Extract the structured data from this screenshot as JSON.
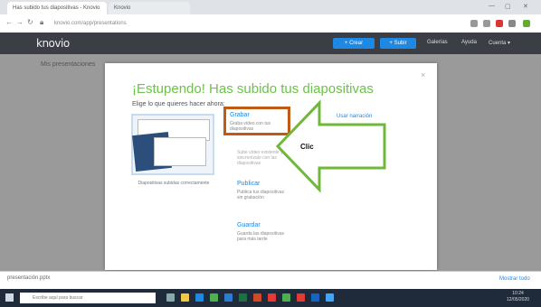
{
  "browser": {
    "tabs": [
      {
        "label": "Has subido tus diapositivas - Knovio"
      },
      {
        "label": "Knovio"
      }
    ],
    "url": "knovio.com/app/presentations",
    "controls": [
      "—",
      "▢",
      "✕"
    ]
  },
  "app": {
    "logo": "knovio",
    "header_buttons": [
      "+ Crear",
      "+ Subir"
    ],
    "header_links": [
      "Galerías",
      "Ayuda",
      "Cuenta ▾"
    ],
    "page_title": "Mis presentaciones"
  },
  "modal": {
    "title": "¡Estupendo! Has subido tus diapositivas",
    "subtitle": "Elige lo que quieres hacer ahora:",
    "close": "×",
    "thumbnail_caption": "Diapositivas subidas correctamente",
    "options": [
      {
        "title": "Grabar",
        "desc": "Graba vídeo con tus diapositivas"
      },
      {
        "title": "",
        "desc": "Sube vídeo existente y sincronízalo con las diapositivas"
      },
      {
        "title": "Publicar",
        "desc": "Publica tus diapositivas sin grabación"
      },
      {
        "title": "Guardar",
        "desc": "Guarda las diapositivas para más tarde"
      }
    ],
    "right_link": "Usar narración"
  },
  "annotation": {
    "label": "Clic"
  },
  "download_bar": {
    "item": "presentación.pptx",
    "show_all": "Mostrar todo"
  },
  "taskbar": {
    "search_placeholder": "Escribe aquí para buscar",
    "time": "10:24",
    "date": "12/05/2020"
  },
  "colors": {
    "accent": "#1e88e5",
    "title_green": "#6cc24a",
    "highlight": "#c05a15",
    "arrow": "#6fb83a"
  }
}
